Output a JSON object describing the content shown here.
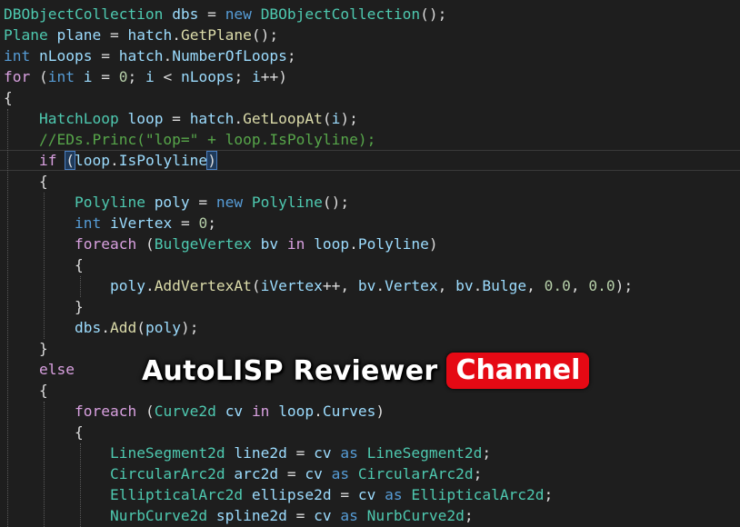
{
  "code_lines": [
    {
      "tokens": [
        [
          "type",
          "DBObjectCollection"
        ],
        [
          "p",
          " "
        ],
        [
          "id",
          "dbs"
        ],
        [
          "p",
          " = "
        ],
        [
          "kw",
          "new"
        ],
        [
          "p",
          " "
        ],
        [
          "type",
          "DBObjectCollection"
        ],
        [
          "p",
          "();"
        ]
      ]
    },
    {
      "tokens": [
        [
          "type",
          "Plane"
        ],
        [
          "p",
          " "
        ],
        [
          "id",
          "plane"
        ],
        [
          "p",
          " = "
        ],
        [
          "id",
          "hatch"
        ],
        [
          "p",
          "."
        ],
        [
          "mth",
          "GetPlane"
        ],
        [
          "p",
          "();"
        ]
      ]
    },
    {
      "tokens": [
        [
          "kw",
          "int"
        ],
        [
          "p",
          " "
        ],
        [
          "id",
          "nLoops"
        ],
        [
          "p",
          " = "
        ],
        [
          "id",
          "hatch"
        ],
        [
          "p",
          "."
        ],
        [
          "id",
          "NumberOfLoops"
        ],
        [
          "p",
          ";"
        ]
      ]
    },
    {
      "tokens": [
        [
          "ctl",
          "for"
        ],
        [
          "p",
          " ("
        ],
        [
          "kw",
          "int"
        ],
        [
          "p",
          " "
        ],
        [
          "id",
          "i"
        ],
        [
          "p",
          " = "
        ],
        [
          "num",
          "0"
        ],
        [
          "p",
          "; "
        ],
        [
          "id",
          "i"
        ],
        [
          "p",
          " < "
        ],
        [
          "id",
          "nLoops"
        ],
        [
          "p",
          "; "
        ],
        [
          "id",
          "i"
        ],
        [
          "p",
          "++)"
        ]
      ]
    },
    {
      "tokens": [
        [
          "p",
          "{"
        ]
      ]
    },
    {
      "tokens": [
        [
          "p",
          "    "
        ],
        [
          "type",
          "HatchLoop"
        ],
        [
          "p",
          " "
        ],
        [
          "id",
          "loop"
        ],
        [
          "p",
          " = "
        ],
        [
          "id",
          "hatch"
        ],
        [
          "p",
          "."
        ],
        [
          "mth",
          "GetLoopAt"
        ],
        [
          "p",
          "("
        ],
        [
          "id",
          "i"
        ],
        [
          "p",
          ");"
        ]
      ]
    },
    {
      "tokens": [
        [
          "p",
          "    "
        ],
        [
          "cmt",
          "//EDs.Princ(\"lop=\" + loop.IsPolyline);"
        ]
      ]
    },
    {
      "tokens": [
        [
          "p",
          "    "
        ],
        [
          "ctl",
          "if"
        ],
        [
          "p",
          " "
        ],
        [
          "hl",
          "("
        ],
        [
          "id",
          "loop"
        ],
        [
          "p",
          "."
        ],
        [
          "id",
          "IsPolyline"
        ],
        [
          "hl",
          ")"
        ]
      ]
    },
    {
      "tokens": [
        [
          "p",
          "    {"
        ]
      ]
    },
    {
      "tokens": [
        [
          "p",
          "        "
        ],
        [
          "type",
          "Polyline"
        ],
        [
          "p",
          " "
        ],
        [
          "id",
          "poly"
        ],
        [
          "p",
          " = "
        ],
        [
          "kw",
          "new"
        ],
        [
          "p",
          " "
        ],
        [
          "type",
          "Polyline"
        ],
        [
          "p",
          "();"
        ]
      ]
    },
    {
      "tokens": [
        [
          "p",
          "        "
        ],
        [
          "kw",
          "int"
        ],
        [
          "p",
          " "
        ],
        [
          "id",
          "iVertex"
        ],
        [
          "p",
          " = "
        ],
        [
          "num",
          "0"
        ],
        [
          "p",
          ";"
        ]
      ]
    },
    {
      "tokens": [
        [
          "p",
          "        "
        ],
        [
          "ctl",
          "foreach"
        ],
        [
          "p",
          " ("
        ],
        [
          "type",
          "BulgeVertex"
        ],
        [
          "p",
          " "
        ],
        [
          "id",
          "bv"
        ],
        [
          "p",
          " "
        ],
        [
          "ctl",
          "in"
        ],
        [
          "p",
          " "
        ],
        [
          "id",
          "loop"
        ],
        [
          "p",
          "."
        ],
        [
          "id",
          "Polyline"
        ],
        [
          "p",
          ")"
        ]
      ]
    },
    {
      "tokens": [
        [
          "p",
          "        {"
        ]
      ]
    },
    {
      "tokens": [
        [
          "p",
          "            "
        ],
        [
          "id",
          "poly"
        ],
        [
          "p",
          "."
        ],
        [
          "mth",
          "AddVertexAt"
        ],
        [
          "p",
          "("
        ],
        [
          "id",
          "iVertex"
        ],
        [
          "p",
          "++, "
        ],
        [
          "id",
          "bv"
        ],
        [
          "p",
          "."
        ],
        [
          "id",
          "Vertex"
        ],
        [
          "p",
          ", "
        ],
        [
          "id",
          "bv"
        ],
        [
          "p",
          "."
        ],
        [
          "id",
          "Bulge"
        ],
        [
          "p",
          ", "
        ],
        [
          "num",
          "0.0"
        ],
        [
          "p",
          ", "
        ],
        [
          "num",
          "0.0"
        ],
        [
          "p",
          ");"
        ]
      ]
    },
    {
      "tokens": [
        [
          "p",
          "        }"
        ]
      ]
    },
    {
      "tokens": [
        [
          "p",
          "        "
        ],
        [
          "id",
          "dbs"
        ],
        [
          "p",
          "."
        ],
        [
          "mth",
          "Add"
        ],
        [
          "p",
          "("
        ],
        [
          "id",
          "poly"
        ],
        [
          "p",
          ");"
        ]
      ]
    },
    {
      "tokens": [
        [
          "p",
          "    }"
        ]
      ]
    },
    {
      "tokens": [
        [
          "p",
          "    "
        ],
        [
          "ctl",
          "else"
        ]
      ]
    },
    {
      "tokens": [
        [
          "p",
          "    {"
        ]
      ]
    },
    {
      "tokens": [
        [
          "p",
          "        "
        ],
        [
          "ctl",
          "foreach"
        ],
        [
          "p",
          " ("
        ],
        [
          "type",
          "Curve2d"
        ],
        [
          "p",
          " "
        ],
        [
          "id",
          "cv"
        ],
        [
          "p",
          " "
        ],
        [
          "ctl",
          "in"
        ],
        [
          "p",
          " "
        ],
        [
          "id",
          "loop"
        ],
        [
          "p",
          "."
        ],
        [
          "id",
          "Curves"
        ],
        [
          "p",
          ")"
        ]
      ]
    },
    {
      "tokens": [
        [
          "p",
          "        {"
        ]
      ]
    },
    {
      "tokens": [
        [
          "p",
          "            "
        ],
        [
          "type",
          "LineSegment2d"
        ],
        [
          "p",
          " "
        ],
        [
          "id",
          "line2d"
        ],
        [
          "p",
          " = "
        ],
        [
          "id",
          "cv"
        ],
        [
          "p",
          " "
        ],
        [
          "kw",
          "as"
        ],
        [
          "p",
          " "
        ],
        [
          "type",
          "LineSegment2d"
        ],
        [
          "p",
          ";"
        ]
      ]
    },
    {
      "tokens": [
        [
          "p",
          "            "
        ],
        [
          "type",
          "CircularArc2d"
        ],
        [
          "p",
          " "
        ],
        [
          "id",
          "arc2d"
        ],
        [
          "p",
          " = "
        ],
        [
          "id",
          "cv"
        ],
        [
          "p",
          " "
        ],
        [
          "kw",
          "as"
        ],
        [
          "p",
          " "
        ],
        [
          "type",
          "CircularArc2d"
        ],
        [
          "p",
          ";"
        ]
      ]
    },
    {
      "tokens": [
        [
          "p",
          "            "
        ],
        [
          "type",
          "EllipticalArc2d"
        ],
        [
          "p",
          " "
        ],
        [
          "id",
          "ellipse2d"
        ],
        [
          "p",
          " = "
        ],
        [
          "id",
          "cv"
        ],
        [
          "p",
          " "
        ],
        [
          "kw",
          "as"
        ],
        [
          "p",
          " "
        ],
        [
          "type",
          "EllipticalArc2d"
        ],
        [
          "p",
          ";"
        ]
      ]
    },
    {
      "tokens": [
        [
          "p",
          "            "
        ],
        [
          "type",
          "NurbCurve2d"
        ],
        [
          "p",
          " "
        ],
        [
          "id",
          "spline2d"
        ],
        [
          "p",
          " = "
        ],
        [
          "id",
          "cv"
        ],
        [
          "p",
          " "
        ],
        [
          "kw",
          "as"
        ],
        [
          "p",
          " "
        ],
        [
          "type",
          "NurbCurve2d"
        ],
        [
          "p",
          ";"
        ]
      ]
    }
  ],
  "watermark": {
    "text": "AutoLISP Reviewer",
    "badge": "Channel",
    "badge_color": "#e50914"
  },
  "colors": {
    "background": "#1e1e1e",
    "keyword": "#569cd6",
    "control": "#d8a0df",
    "type": "#4ec9b0",
    "identifier": "#9cdcfe",
    "method": "#dcdcaa",
    "number": "#b5cea8",
    "comment": "#57a64a"
  }
}
